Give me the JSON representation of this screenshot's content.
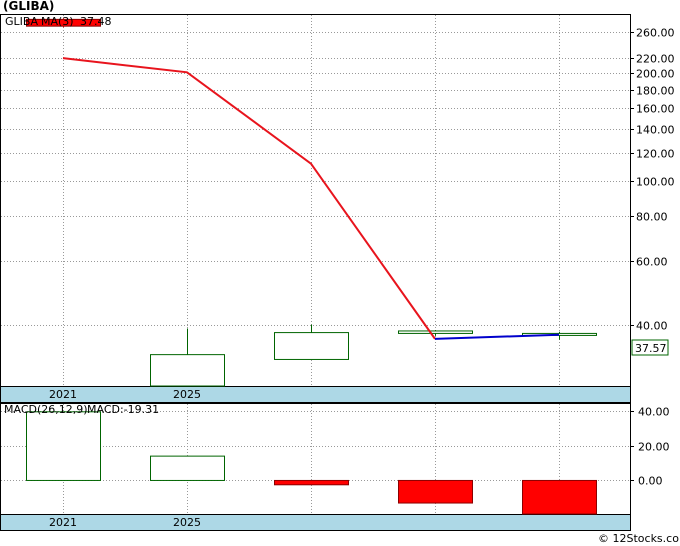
{
  "title": "(GLIBA)",
  "legend": {
    "symbol": "GLIBA",
    "symbol_color": "#006400",
    "ma_label": "MA(3)",
    "ma_value": "37.48",
    "ma_color": "#00008b"
  },
  "last_price": "37.57",
  "watermark": "© 12Stocks.com",
  "colors": {
    "up": "#006400",
    "down": "#ff0000",
    "ma": "#0000cc",
    "line": "#e8141d",
    "axis_band": "#add8e6"
  },
  "chart_data": [
    {
      "type": "candlestick",
      "title": "(GLIBA)",
      "y_scale": "log",
      "ylim": [
        27,
        290
      ],
      "y_ticks": [
        40,
        60,
        80,
        100,
        120,
        140,
        160,
        180,
        200,
        220,
        260
      ],
      "y_tick_labels": [
        "40.00",
        "60.00",
        "80.00",
        "100.00",
        "120.00",
        "140.00",
        "160.00",
        "180.00",
        "200.00",
        "220.00",
        "260.00"
      ],
      "x_tick_labels": [
        {
          "index": 0,
          "label": "2021"
        },
        {
          "index": 1,
          "label": "2025"
        }
      ],
      "candles": [
        {
          "index": 0,
          "open": 270,
          "close": 282,
          "high": 284,
          "low": 268,
          "color": "down"
        },
        {
          "index": 1,
          "open": 27,
          "close": 33,
          "high": 39,
          "low": 27,
          "color": "up"
        },
        {
          "index": 2,
          "open": 32,
          "close": 38,
          "high": 40,
          "low": 32,
          "color": "up"
        },
        {
          "index": 3,
          "open": 37.8,
          "close": 38.4,
          "high": 38.6,
          "low": 37.2,
          "color": "up"
        },
        {
          "index": 4,
          "open": 37.4,
          "close": 37.8,
          "high": 38.2,
          "low": 36.3,
          "color": "up"
        }
      ],
      "price_line": {
        "x": [
          0,
          1,
          2,
          3
        ],
        "values": [
          220,
          201,
          112,
          36.5
        ]
      },
      "ma_line": {
        "x": [
          3,
          4
        ],
        "values": [
          36.5,
          37.48
        ]
      }
    },
    {
      "type": "bar",
      "title": "MACD(26,12,9)",
      "label": "MACD(26,12,9)",
      "value_label": "MACD:-19.31",
      "ylim": [
        -19.31,
        44
      ],
      "y_ticks": [
        0,
        20,
        40
      ],
      "y_tick_labels": [
        "0.00",
        "20.00",
        "40.00"
      ],
      "x_tick_labels": [
        {
          "index": 0,
          "label": "2021"
        },
        {
          "index": 1,
          "label": "2025"
        }
      ],
      "values": [
        39.5,
        14,
        -2.5,
        -13,
        -19.31
      ],
      "colors": [
        "up",
        "up",
        "down",
        "down",
        "down"
      ]
    }
  ]
}
